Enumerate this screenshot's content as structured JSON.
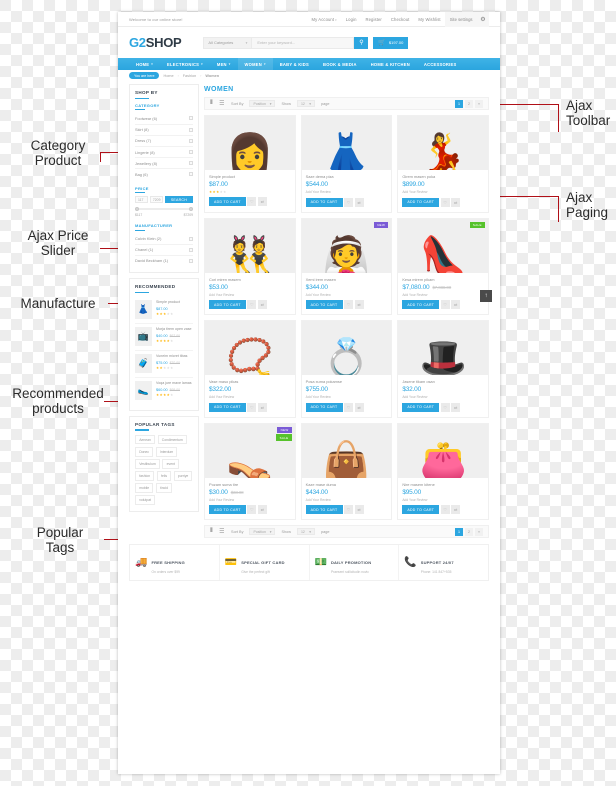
{
  "annotations": {
    "left": [
      {
        "text": "Category\nProduct"
      },
      {
        "text": "Ajax Price\nSlider"
      },
      {
        "text": "Manufacture"
      },
      {
        "text": "Recommended\nproducts"
      },
      {
        "text": "Popular\nTags"
      }
    ],
    "right": [
      {
        "text": "Ajax\nToolbar"
      },
      {
        "text": "Ajax\nPaging"
      }
    ]
  },
  "topbar": {
    "welcome": "Welcome to our online store!",
    "links": [
      "My Account",
      "Login",
      "Register",
      "Checkout",
      "My Wishlist"
    ],
    "site_settings": "Site settings",
    "gear_icon": "⚙"
  },
  "header": {
    "logo_g2": "G2",
    "logo_shop": "SHOP",
    "category_select": "All Categories",
    "search_placeholder": "Enter your keyword...",
    "search_icon": "⚲",
    "cart_icon": "🛒",
    "cart_total": "$197.00"
  },
  "nav": {
    "items": [
      {
        "label": "HOME",
        "caret": "▾",
        "active": false
      },
      {
        "label": "ELECTRONICS",
        "caret": "▾",
        "active": false
      },
      {
        "label": "MEN",
        "caret": "▾",
        "active": false
      },
      {
        "label": "WOMEN",
        "caret": "▾",
        "active": true
      },
      {
        "label": "BABY & KIDS",
        "caret": "",
        "active": false
      },
      {
        "label": "BOOK & MEDIA",
        "caret": "",
        "active": false
      },
      {
        "label": "HOME & KITCHEN",
        "caret": "",
        "active": false
      },
      {
        "label": "ACCESSORIES",
        "caret": "",
        "active": false
      }
    ]
  },
  "breadcrumb": {
    "badge": "You are here",
    "items": [
      "Home",
      "Fashion"
    ],
    "current": "Women",
    "separator": "›"
  },
  "sidebar": {
    "shop_by_title": "SHOP BY",
    "category": {
      "title": "CATEGORY",
      "items": [
        {
          "label": "Footwear (6)"
        },
        {
          "label": "Skirt (8)"
        },
        {
          "label": "Dress (7)"
        },
        {
          "label": "Lingerie (8)"
        },
        {
          "label": "Jewellery (8)"
        },
        {
          "label": "Bag (6)"
        }
      ]
    },
    "price": {
      "title": "PRICE",
      "min_value": "117",
      "max_value": "7209",
      "search_label": "SEARCH",
      "range_min": "$117",
      "range_max": "$7209"
    },
    "manufacturer": {
      "title": "MANUFACTURER",
      "items": [
        {
          "label": "Calvin Klein (2)"
        },
        {
          "label": "Chanel (1)"
        },
        {
          "label": "David Beckham (1)"
        }
      ]
    },
    "recommended": {
      "title": "RECOMMENDED",
      "items": [
        {
          "thumb": "👗",
          "name": "Simple product",
          "price": "$87.00",
          "old": "",
          "stars": 3
        },
        {
          "thumb": "📺",
          "name": "Morja tirem open zase",
          "price": "$40.00",
          "old": "$67.00",
          "stars": 4
        },
        {
          "thumb": "🧳",
          "name": "Vuneim micret tibas",
          "price": "$75.00",
          "old": "$70.00",
          "stars": 2
        },
        {
          "thumb": "🥿",
          "name": "Voqa jure maxe lamas",
          "price": "$60.00",
          "old": "$69.00",
          "stars": 4
        }
      ]
    },
    "popular_tags": {
      "title": "POPULAR TAGS",
      "tags": [
        "Aenean",
        "Condimentum",
        "Donec",
        "Interdum",
        "Vestibulum",
        "event",
        "fashion",
        "felis",
        "purriye",
        "mobile",
        "tincid",
        "volutpat"
      ]
    }
  },
  "main": {
    "page_title": "WOMEN",
    "toolbar": {
      "grid_icon": "⦀",
      "list_icon": "☰",
      "sort_label": "Sort By",
      "sort_value": "Position",
      "show_label": "Show",
      "show_value": "12",
      "per_page_label": "page",
      "caret": "▾",
      "pages": [
        "1",
        "2",
        "»"
      ],
      "current_page": "1"
    },
    "add_to_cart_label": "ADD TO CART",
    "wishlist_icon": "♡",
    "compare_icon": "⇄",
    "review_label": "Add Your Review",
    "scroll_top_icon": "↑",
    "products": [
      {
        "emoji": "👩",
        "name": "Simple product",
        "price": "$87.00",
        "old": "",
        "stars": 3,
        "badges": []
      },
      {
        "emoji": "👗",
        "name": "Saze dema piza",
        "price": "$544.00",
        "old": "",
        "stars": 0,
        "badges": []
      },
      {
        "emoji": "💃",
        "name": "Girem masen poka",
        "price": "$899.00",
        "old": "",
        "stars": 0,
        "badges": []
      },
      {
        "emoji": "👯",
        "name": "Cori miren masem",
        "price": "$53.00",
        "old": "",
        "stars": 0,
        "badges": []
      },
      {
        "emoji": "👰",
        "name": "Xemi irem masen",
        "price": "$344.00",
        "old": "",
        "stars": 0,
        "badges": [
          "NEW"
        ]
      },
      {
        "emoji": "👠",
        "name": "Kesa mirem pikam",
        "price": "$7,080.00",
        "old": "$7,088.00",
        "stars": 0,
        "badges": [
          "SALE"
        ]
      },
      {
        "emoji": "📿",
        "name": "Vase maso pikas",
        "price": "$322.00",
        "old": "",
        "stars": 0,
        "badges": []
      },
      {
        "emoji": "💍",
        "name": "Posa xuma pokamse",
        "price": "$755.00",
        "old": "",
        "stars": 0,
        "badges": []
      },
      {
        "emoji": "🎩",
        "name": "Jasene tikam osan",
        "price": "$32.00",
        "old": "",
        "stars": 0,
        "badges": []
      },
      {
        "emoji": "👡",
        "name": "Pozam suma tire",
        "price": "$30.00",
        "old": "$33.00",
        "stars": 0,
        "badges": [
          "NEW",
          "SALE"
        ]
      },
      {
        "emoji": "👜",
        "name": "Kaze mase duma",
        "price": "$434.00",
        "old": "",
        "stars": 0,
        "badges": []
      },
      {
        "emoji": "👛",
        "name": "Nire masem kitene",
        "price": "$95.00",
        "old": "",
        "stars": 0,
        "badges": []
      }
    ]
  },
  "services": [
    {
      "icon": "🚚",
      "title": "FREE SHIPPING",
      "sub": "On orders over $99"
    },
    {
      "icon": "💳",
      "title": "SPECIAL GIFT CARD",
      "sub": "Give the perfect gift"
    },
    {
      "icon": "💵",
      "title": "DAILY PROMOTION",
      "sub": "Praesent sollicitudin novic"
    },
    {
      "icon": "📞",
      "title": "SUPPORT 24/07",
      "sub": "Phone: 141 847+535"
    }
  ],
  "colors": {
    "accent": "#2ca6e0",
    "badge_new": "#7a5bd6",
    "badge_sale": "#56c22b",
    "star": "#ffb400",
    "annotation": "#b01018"
  }
}
